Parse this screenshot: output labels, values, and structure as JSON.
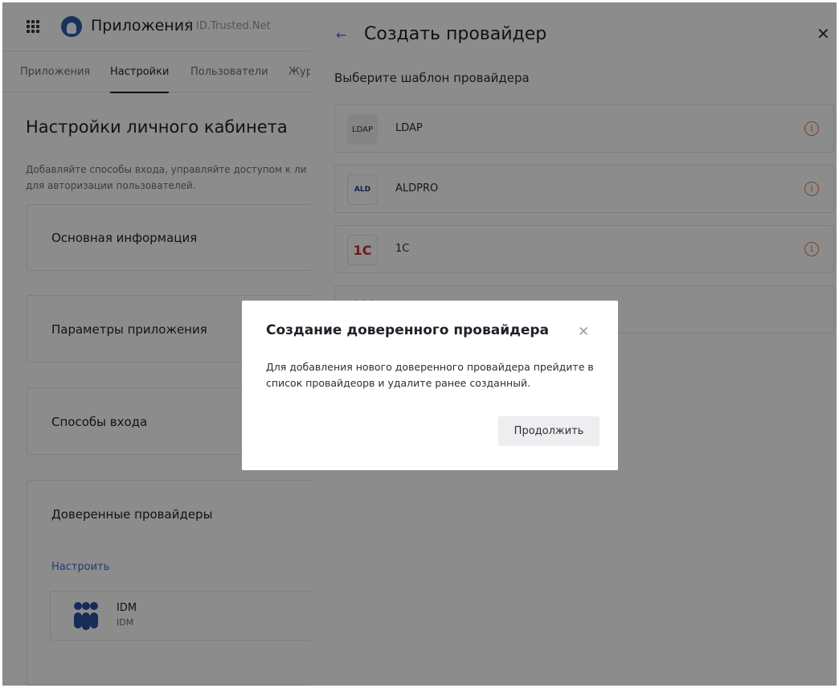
{
  "app": {
    "title": "Приложения",
    "subtitle": "ID.Trusted.Net",
    "tabs": [
      "Приложения",
      "Настройки",
      "Пользователи",
      "Жур"
    ],
    "page_title": "Настройки личного кабинета",
    "page_desc_line1": "Добавляйте способы входа, управляйте доступом к ли",
    "page_desc_line2": "для авторизации пользователей.",
    "cards": [
      "Основная информация",
      "Параметры приложения",
      "Способы входа",
      "Доверенные провайдеры"
    ],
    "configure_link": "Настроить",
    "idm_item": {
      "name": "IDM",
      "sub": "IDM"
    }
  },
  "drawer": {
    "title": "Создать провайдер",
    "subtitle": "Выберите шаблон провайдера",
    "providers": [
      {
        "name": "LDAP",
        "logo_text": "LDAP"
      },
      {
        "name": "ALDPRO",
        "logo_text": "ALD"
      },
      {
        "name": "1C",
        "logo_text": "1С"
      }
    ]
  },
  "modal": {
    "title": "Создание доверенного провайдера",
    "text": "Для добавления нового доверенного провайдера прейдите в список провайдеорв и удалите ранее созданный.",
    "button": "Продолжить"
  },
  "colors": {
    "accent": "#3b6fd6",
    "info": "#e57a3c",
    "idm_logo": "#2f4fa3"
  }
}
